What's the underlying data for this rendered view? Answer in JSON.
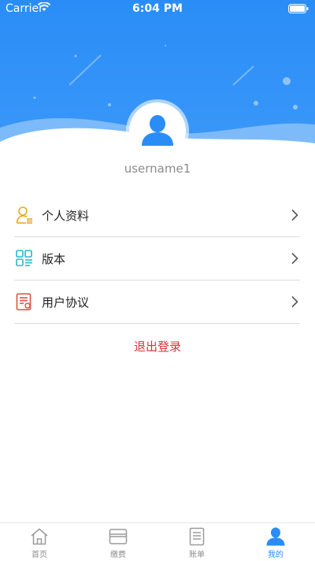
{
  "status_bar": {
    "carrier": "Carrier",
    "time": "6:04 PM"
  },
  "profile": {
    "username": "username1"
  },
  "menu": {
    "items": [
      {
        "label": "个人资料",
        "icon": "profile-icon"
      },
      {
        "label": "版本",
        "icon": "version-icon"
      },
      {
        "label": "用户协议",
        "icon": "agreement-icon"
      }
    ],
    "logout_label": "退出登录"
  },
  "tabbar": {
    "tabs": [
      {
        "label": "首页",
        "icon": "home-icon",
        "active": false
      },
      {
        "label": "缴费",
        "icon": "card-icon",
        "active": false
      },
      {
        "label": "账单",
        "icon": "bill-icon",
        "active": false
      },
      {
        "label": "我的",
        "icon": "user-icon",
        "active": true
      }
    ]
  },
  "colors": {
    "brand": "#2a8df7",
    "logout": "#d9323a"
  }
}
